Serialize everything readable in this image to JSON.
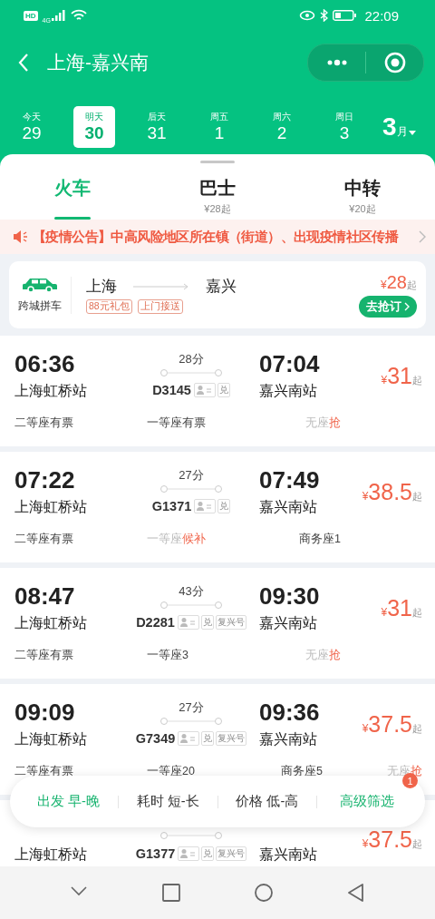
{
  "status_bar": {
    "hd": "HD",
    "network": "4G",
    "time": "22:09"
  },
  "header": {
    "title": "上海-嘉兴南"
  },
  "dates": [
    {
      "label": "今天",
      "day": "29",
      "selected": false
    },
    {
      "label": "明天",
      "day": "30",
      "selected": true
    },
    {
      "label": "后天",
      "day": "31",
      "selected": false
    },
    {
      "label": "周五",
      "day": "1",
      "selected": false
    },
    {
      "label": "周六",
      "day": "2",
      "selected": false
    },
    {
      "label": "周日",
      "day": "3",
      "selected": false
    }
  ],
  "month": {
    "number": "3",
    "unit": "月"
  },
  "tabs": [
    {
      "label": "火车",
      "selected": true
    },
    {
      "label": "巴士",
      "price": "¥28起",
      "selected": false
    },
    {
      "label": "中转",
      "price": "¥20起",
      "selected": false
    }
  ],
  "notice": {
    "text": "【疫情公告】中高风险地区所在镇（街道）、出现疫情社区传播"
  },
  "carpool": {
    "label": "跨城拼车",
    "from": "上海",
    "to": "嘉兴",
    "tags": [
      "88元礼包",
      "上门接送"
    ],
    "currency": "¥",
    "price": "28",
    "suffix": "起",
    "button": "去抢订"
  },
  "trains": [
    {
      "depart": "06:36",
      "from": "上海虹桥站",
      "duration": "28分",
      "number": "D3145",
      "tags": [
        "兑"
      ],
      "arrive": "07:04",
      "to": "嘉兴南站",
      "currency": "¥",
      "price": "31",
      "suffix": "起",
      "seats": [
        {
          "kind": "plain",
          "text": "二等座有票"
        },
        {
          "kind": "plain",
          "text": "一等座有票"
        },
        {
          "kind": "action",
          "text": "无座",
          "action": "抢"
        }
      ]
    },
    {
      "depart": "07:22",
      "from": "上海虹桥站",
      "duration": "27分",
      "number": "G1371",
      "tags": [
        "兑"
      ],
      "arrive": "07:49",
      "to": "嘉兴南站",
      "currency": "¥",
      "price": "38.5",
      "suffix": "起",
      "seats": [
        {
          "kind": "plain",
          "text": "二等座有票"
        },
        {
          "kind": "action",
          "text": "一等座",
          "action": "候补"
        },
        {
          "kind": "plain",
          "text": "商务座1"
        }
      ]
    },
    {
      "depart": "08:47",
      "from": "上海虹桥站",
      "duration": "43分",
      "number": "D2281",
      "tags": [
        "兑",
        "复兴号"
      ],
      "arrive": "09:30",
      "to": "嘉兴南站",
      "currency": "¥",
      "price": "31",
      "suffix": "起",
      "seats": [
        {
          "kind": "plain",
          "text": "二等座有票"
        },
        {
          "kind": "plain",
          "text": "一等座3"
        },
        {
          "kind": "action",
          "text": "无座",
          "action": "抢"
        }
      ]
    },
    {
      "depart": "09:09",
      "from": "上海虹桥站",
      "duration": "27分",
      "number": "G7349",
      "tags": [
        "兑",
        "复兴号"
      ],
      "arrive": "09:36",
      "to": "嘉兴南站",
      "currency": "¥",
      "price": "37.5",
      "suffix": "起",
      "seats": [
        {
          "kind": "plain",
          "text": "二等座有票"
        },
        {
          "kind": "plain",
          "text": "一等座20"
        },
        {
          "kind": "plain",
          "text": "商务座5"
        },
        {
          "kind": "action",
          "text": "无座",
          "action": "抢"
        }
      ]
    },
    {
      "from": "上海虹桥站",
      "number": "G1377",
      "tags": [
        "兑",
        "复兴号"
      ],
      "to": "嘉兴南站",
      "currency": "¥",
      "price": "37.5",
      "suffix": "起"
    }
  ],
  "filters": [
    {
      "label": "出发 早-晚",
      "selected": true
    },
    {
      "label": "耗时 短-长",
      "selected": false
    },
    {
      "label": "价格 低-高",
      "selected": false
    },
    {
      "label": "高级筛选",
      "selected": true,
      "badge": "1"
    }
  ]
}
